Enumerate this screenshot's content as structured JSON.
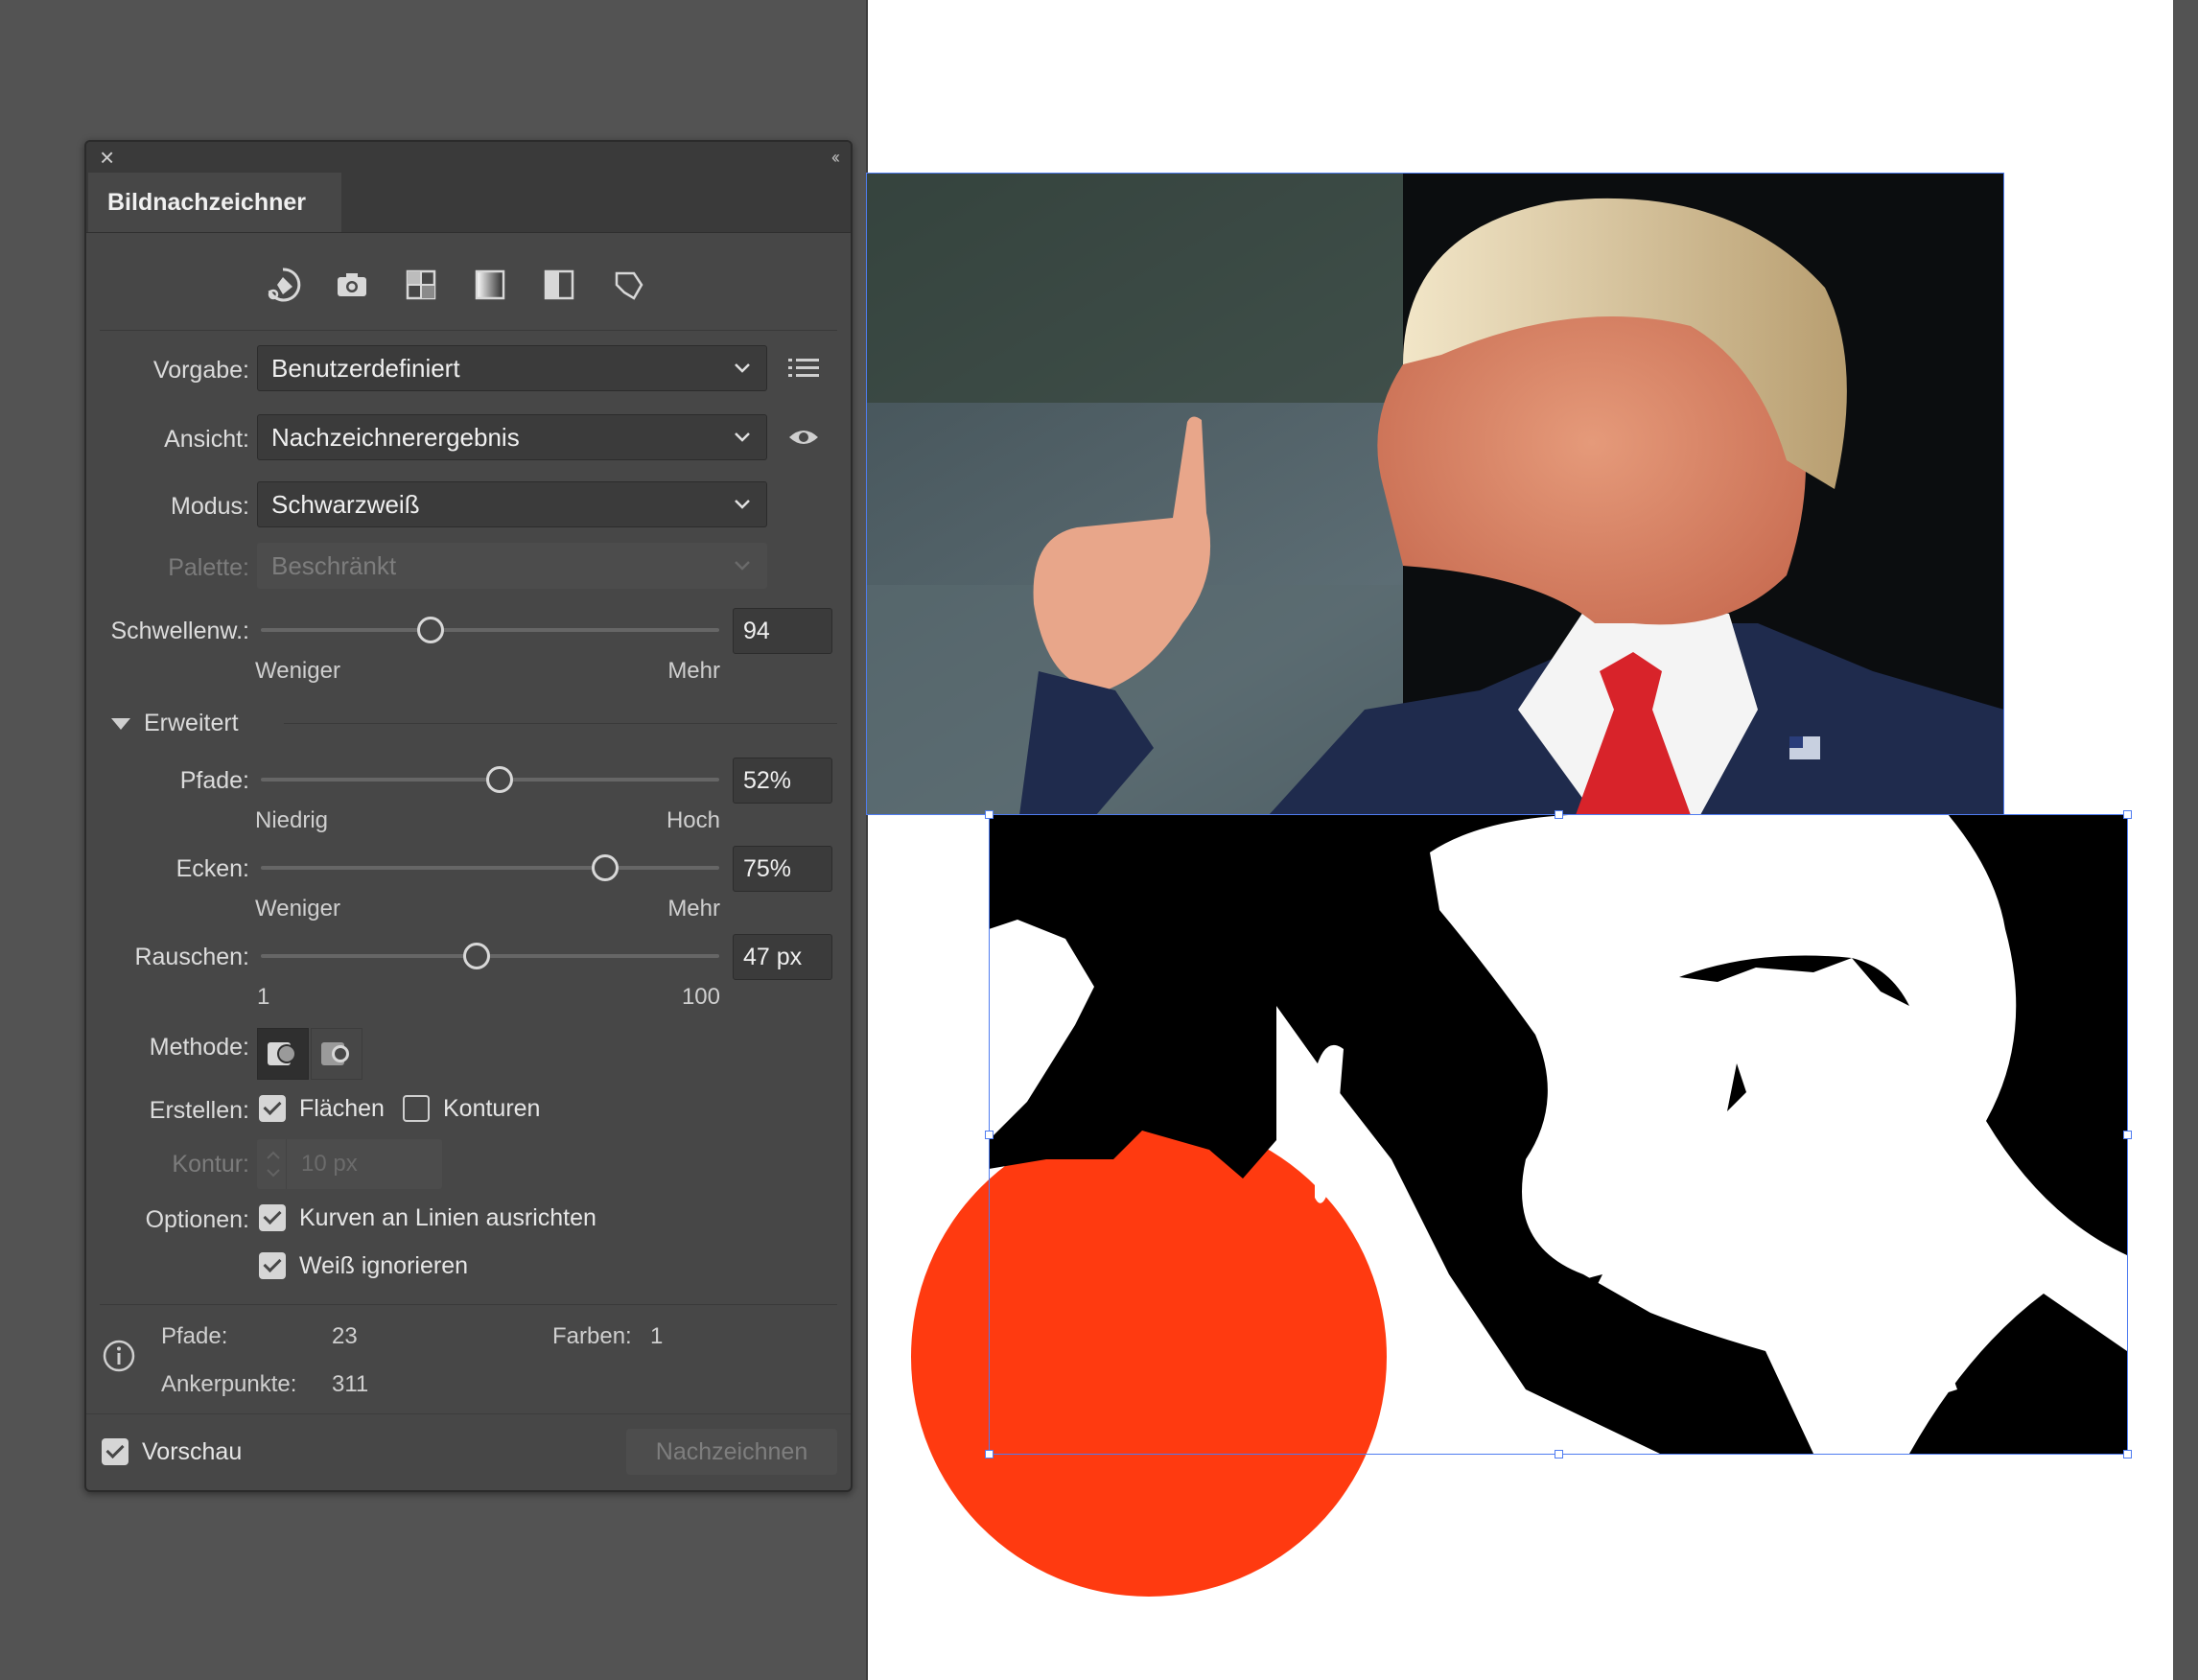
{
  "panel": {
    "title": "Bildnachzeichner",
    "preset_label": "Vorgabe:",
    "preset_value": "Benutzerdefiniert",
    "view_label": "Ansicht:",
    "view_value": "Nachzeichnerergebnis",
    "mode_label": "Modus:",
    "mode_value": "Schwarzweiß",
    "palette_label": "Palette:",
    "palette_value": "Beschränkt",
    "threshold": {
      "label": "Schwellenw.:",
      "value": "94",
      "min_label": "Weniger",
      "max_label": "Mehr",
      "fraction": 0.37
    },
    "advanced_label": "Erweitert",
    "paths": {
      "label": "Pfade:",
      "value": "52%",
      "min_label": "Niedrig",
      "max_label": "Hoch",
      "fraction": 0.52
    },
    "corners": {
      "label": "Ecken:",
      "value": "75%",
      "min_label": "Weniger",
      "max_label": "Mehr",
      "fraction": 0.75
    },
    "noise": {
      "label": "Rauschen:",
      "value": "47 px",
      "min_label": "1",
      "max_label": "100",
      "fraction": 0.47
    },
    "method_label": "Methode:",
    "create_label": "Erstellen:",
    "fills_label": "Flächen",
    "strokes_label": "Konturen",
    "stroke_label": "Kontur:",
    "stroke_value": "10 px",
    "options_label": "Optionen:",
    "snap_curves_label": "Kurven an Linien ausrichten",
    "ignore_white_label": "Weiß ignorieren",
    "info": {
      "paths_label": "Pfade:",
      "paths_value": "23",
      "colors_label": "Farben:",
      "colors_value": "1",
      "anchors_label": "Ankerpunkte:",
      "anchors_value": "311"
    },
    "preview_label": "Vorschau",
    "trace_button": "Nachzeichnen"
  },
  "icons": [
    "close-icon",
    "collapse-icon",
    "auto-color-icon",
    "high-color-icon",
    "low-color-icon",
    "grayscale-icon",
    "black-white-icon",
    "outline-icon",
    "menu-list-icon",
    "eye-icon",
    "chevron-down-icon",
    "info-icon"
  ],
  "colors": {
    "accent_circle": "#ff3a10",
    "selection": "#4f7cf0",
    "tie": "#d8232a",
    "suit": "#1f2b4d"
  }
}
